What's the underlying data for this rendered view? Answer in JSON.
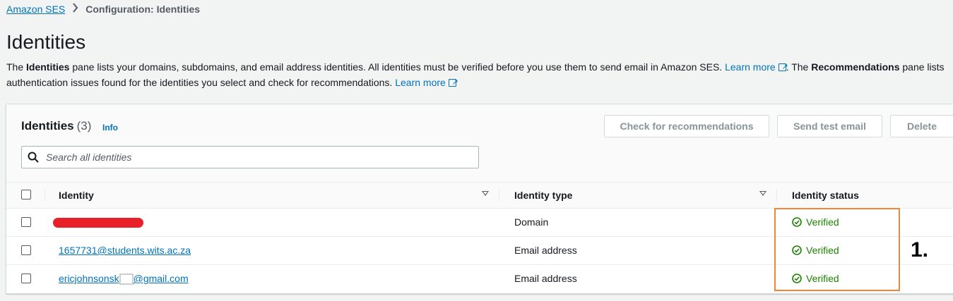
{
  "breadcrumb": {
    "root": "Amazon SES",
    "current": "Configuration: Identities"
  },
  "page": {
    "title": "Identities",
    "description_1": "The ",
    "description_bold_1": "Identities",
    "description_2": " pane lists your domains, subdomains, and email address identities. All identities must be verified before you use them to send email in Amazon SES. ",
    "learn_more_1": "Learn more",
    "description_3": ". The ",
    "description_bold_2": "Recommendations",
    "description_4": " pane lists",
    "description_line2": "authentication issues found for the identities you select and check for recommendations. ",
    "learn_more_2": "Learn more"
  },
  "panel": {
    "title": "Identities",
    "count": "(3)",
    "info": "Info",
    "buttons": {
      "check": "Check for recommendations",
      "send": "Send test email",
      "delete": "Delete"
    },
    "search_placeholder": "Search all identities"
  },
  "table": {
    "headers": {
      "identity": "Identity",
      "type": "Identity type",
      "status": "Identity status"
    },
    "rows": [
      {
        "identity": "",
        "type": "Domain",
        "status": "Verified"
      },
      {
        "identity": "1657731@students.wits.ac.za",
        "type": "Email address",
        "status": "Verified"
      },
      {
        "identity_prefix": "ericjohnsonsk",
        "identity_suffix": "@gmail.com",
        "type": "Email address",
        "status": "Verified"
      }
    ]
  },
  "annotation": {
    "label": "1."
  },
  "colors": {
    "link": "#0073bb",
    "verified": "#1d8102",
    "highlight": "#f58536",
    "redaction": "#e8202a"
  },
  "icons": [
    "chevron-right-icon",
    "external-link-icon",
    "search-icon",
    "sort-caret-icon",
    "check-circle-icon"
  ]
}
